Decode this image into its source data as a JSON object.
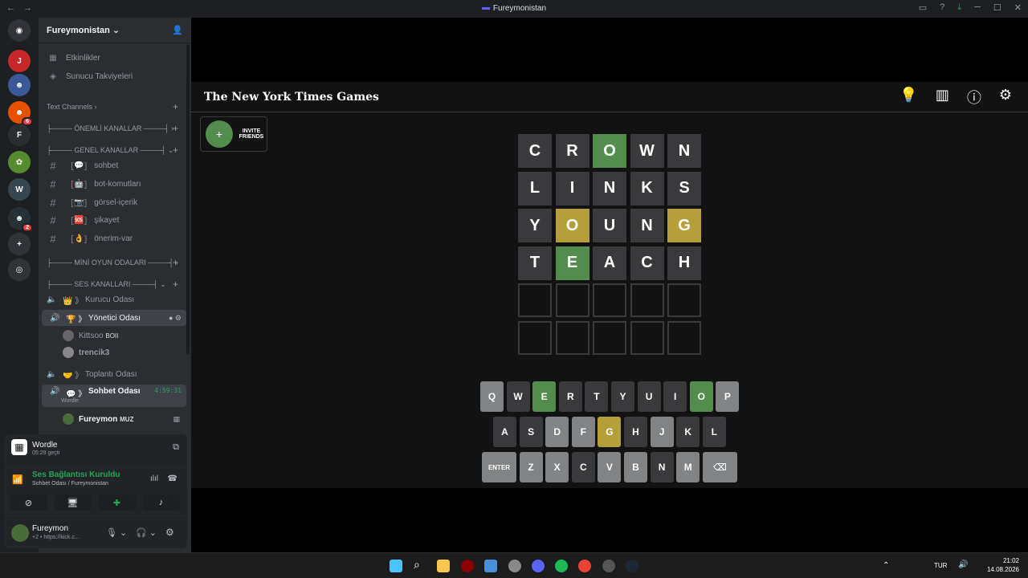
{
  "window": {
    "title": "Fureymonistan"
  },
  "server": {
    "name": "Fureymonistan"
  },
  "server_rail": {
    "items": [
      {
        "name": "discord-home-icon",
        "color": "#313338"
      },
      {
        "name": "server-icon-1",
        "color": "#c62828"
      },
      {
        "name": "server-icon-2",
        "color": "#3b5998"
      },
      {
        "name": "server-icon-3",
        "color": "#e65100",
        "badge": "6"
      },
      {
        "name": "server-icon-fureymonistan",
        "color": "#2b2d31"
      },
      {
        "name": "server-icon-5",
        "color": "#558b2f"
      },
      {
        "name": "server-icon-6",
        "color": "#37474f"
      },
      {
        "name": "server-icon-7",
        "color": "#263238",
        "badge": "2"
      },
      {
        "name": "add-server-icon",
        "color": "#313338"
      },
      {
        "name": "discover-icon",
        "color": "#313338"
      }
    ]
  },
  "sidebar": {
    "top_items": [
      {
        "label": "Etkinlikler"
      },
      {
        "label": "Sunucu Takviyeleri"
      }
    ],
    "categories": {
      "text": "Text Channels",
      "important": "├──── ÖNEMLİ KANALLAR ────┤",
      "general": "├──── GENEL KANALLAR ────┤",
      "mini": "├──── MİNİ OYUN ODALARI ────┤",
      "voice": "├──── SES KANALLARI ────┤"
    },
    "text_channels": [
      {
        "label": "sohbet",
        "emoji": "💬"
      },
      {
        "label": "bot-komutları",
        "emoji": "🤖"
      },
      {
        "label": "görsel-içerik",
        "emoji": "📷"
      },
      {
        "label": "şikayet",
        "emoji": "🆘"
      },
      {
        "label": "önerim-var",
        "emoji": "👌"
      }
    ],
    "voice_channels": {
      "kurucu": "Kurucu Odası",
      "yonetici": "Yönetici Odası",
      "toplanti": "Toplantı Odası",
      "sohbet": "Sohbet Odası",
      "sohbet_timer": "4:59:31",
      "sohbet_activity": "Wordle"
    },
    "voice_users": {
      "user1": "Kittsoo",
      "user1_tag": "BOII",
      "user2": "trencik3",
      "user3": "Fureymon",
      "user3_tag": "MUZ"
    }
  },
  "activity_panel": {
    "title": "Wordle",
    "elapsed": "05:29 geçti",
    "voice_status": "Ses Bağlantısı Kuruldu",
    "voice_location": "Sohbet Odası / Fureymonistan",
    "user_name": "Fureymon",
    "user_status": "+2 • https://kick.c..."
  },
  "nyt": {
    "logo": "The New York Times Games",
    "invite": "INVITE FRIENDS"
  },
  "colors": {
    "correct": "#538d4e",
    "present": "#b59f3b",
    "absent": "#3a3a3c",
    "key_default": "#818384"
  },
  "wordle": {
    "rows": [
      [
        {
          "l": "C",
          "s": "absent"
        },
        {
          "l": "R",
          "s": "absent"
        },
        {
          "l": "O",
          "s": "correct"
        },
        {
          "l": "W",
          "s": "absent"
        },
        {
          "l": "N",
          "s": "absent"
        }
      ],
      [
        {
          "l": "L",
          "s": "absent"
        },
        {
          "l": "I",
          "s": "absent"
        },
        {
          "l": "N",
          "s": "absent"
        },
        {
          "l": "K",
          "s": "absent"
        },
        {
          "l": "S",
          "s": "absent"
        }
      ],
      [
        {
          "l": "Y",
          "s": "absent"
        },
        {
          "l": "O",
          "s": "present"
        },
        {
          "l": "U",
          "s": "absent"
        },
        {
          "l": "N",
          "s": "absent"
        },
        {
          "l": "G",
          "s": "present"
        }
      ],
      [
        {
          "l": "T",
          "s": "absent"
        },
        {
          "l": "E",
          "s": "correct"
        },
        {
          "l": "A",
          "s": "absent"
        },
        {
          "l": "C",
          "s": "absent"
        },
        {
          "l": "H",
          "s": "absent"
        }
      ],
      [
        {
          "l": "",
          "s": "empty"
        },
        {
          "l": "",
          "s": "empty"
        },
        {
          "l": "",
          "s": "empty"
        },
        {
          "l": "",
          "s": "empty"
        },
        {
          "l": "",
          "s": "empty"
        }
      ],
      [
        {
          "l": "",
          "s": "empty"
        },
        {
          "l": "",
          "s": "empty"
        },
        {
          "l": "",
          "s": "empty"
        },
        {
          "l": "",
          "s": "empty"
        },
        {
          "l": "",
          "s": "empty"
        }
      ]
    ],
    "keyboard": [
      [
        {
          "k": "Q",
          "s": "default"
        },
        {
          "k": "W",
          "s": "absent"
        },
        {
          "k": "E",
          "s": "correct"
        },
        {
          "k": "R",
          "s": "absent"
        },
        {
          "k": "T",
          "s": "absent"
        },
        {
          "k": "Y",
          "s": "absent"
        },
        {
          "k": "U",
          "s": "absent"
        },
        {
          "k": "I",
          "s": "absent"
        },
        {
          "k": "O",
          "s": "correct"
        },
        {
          "k": "P",
          "s": "default"
        }
      ],
      [
        {
          "k": "A",
          "s": "absent"
        },
        {
          "k": "S",
          "s": "absent"
        },
        {
          "k": "D",
          "s": "default"
        },
        {
          "k": "F",
          "s": "default"
        },
        {
          "k": "G",
          "s": "present"
        },
        {
          "k": "H",
          "s": "absent"
        },
        {
          "k": "J",
          "s": "default"
        },
        {
          "k": "K",
          "s": "absent"
        },
        {
          "k": "L",
          "s": "absent"
        }
      ],
      [
        {
          "k": "ENTER",
          "s": "default"
        },
        {
          "k": "Z",
          "s": "default"
        },
        {
          "k": "X",
          "s": "default"
        },
        {
          "k": "C",
          "s": "absent"
        },
        {
          "k": "V",
          "s": "default"
        },
        {
          "k": "B",
          "s": "default"
        },
        {
          "k": "N",
          "s": "absent"
        },
        {
          "k": "M",
          "s": "default"
        },
        {
          "k": "⌫",
          "s": "default"
        }
      ]
    ]
  },
  "taskbar": {
    "lang": "TUR",
    "time": "21:02",
    "date": "14.08.2026"
  }
}
